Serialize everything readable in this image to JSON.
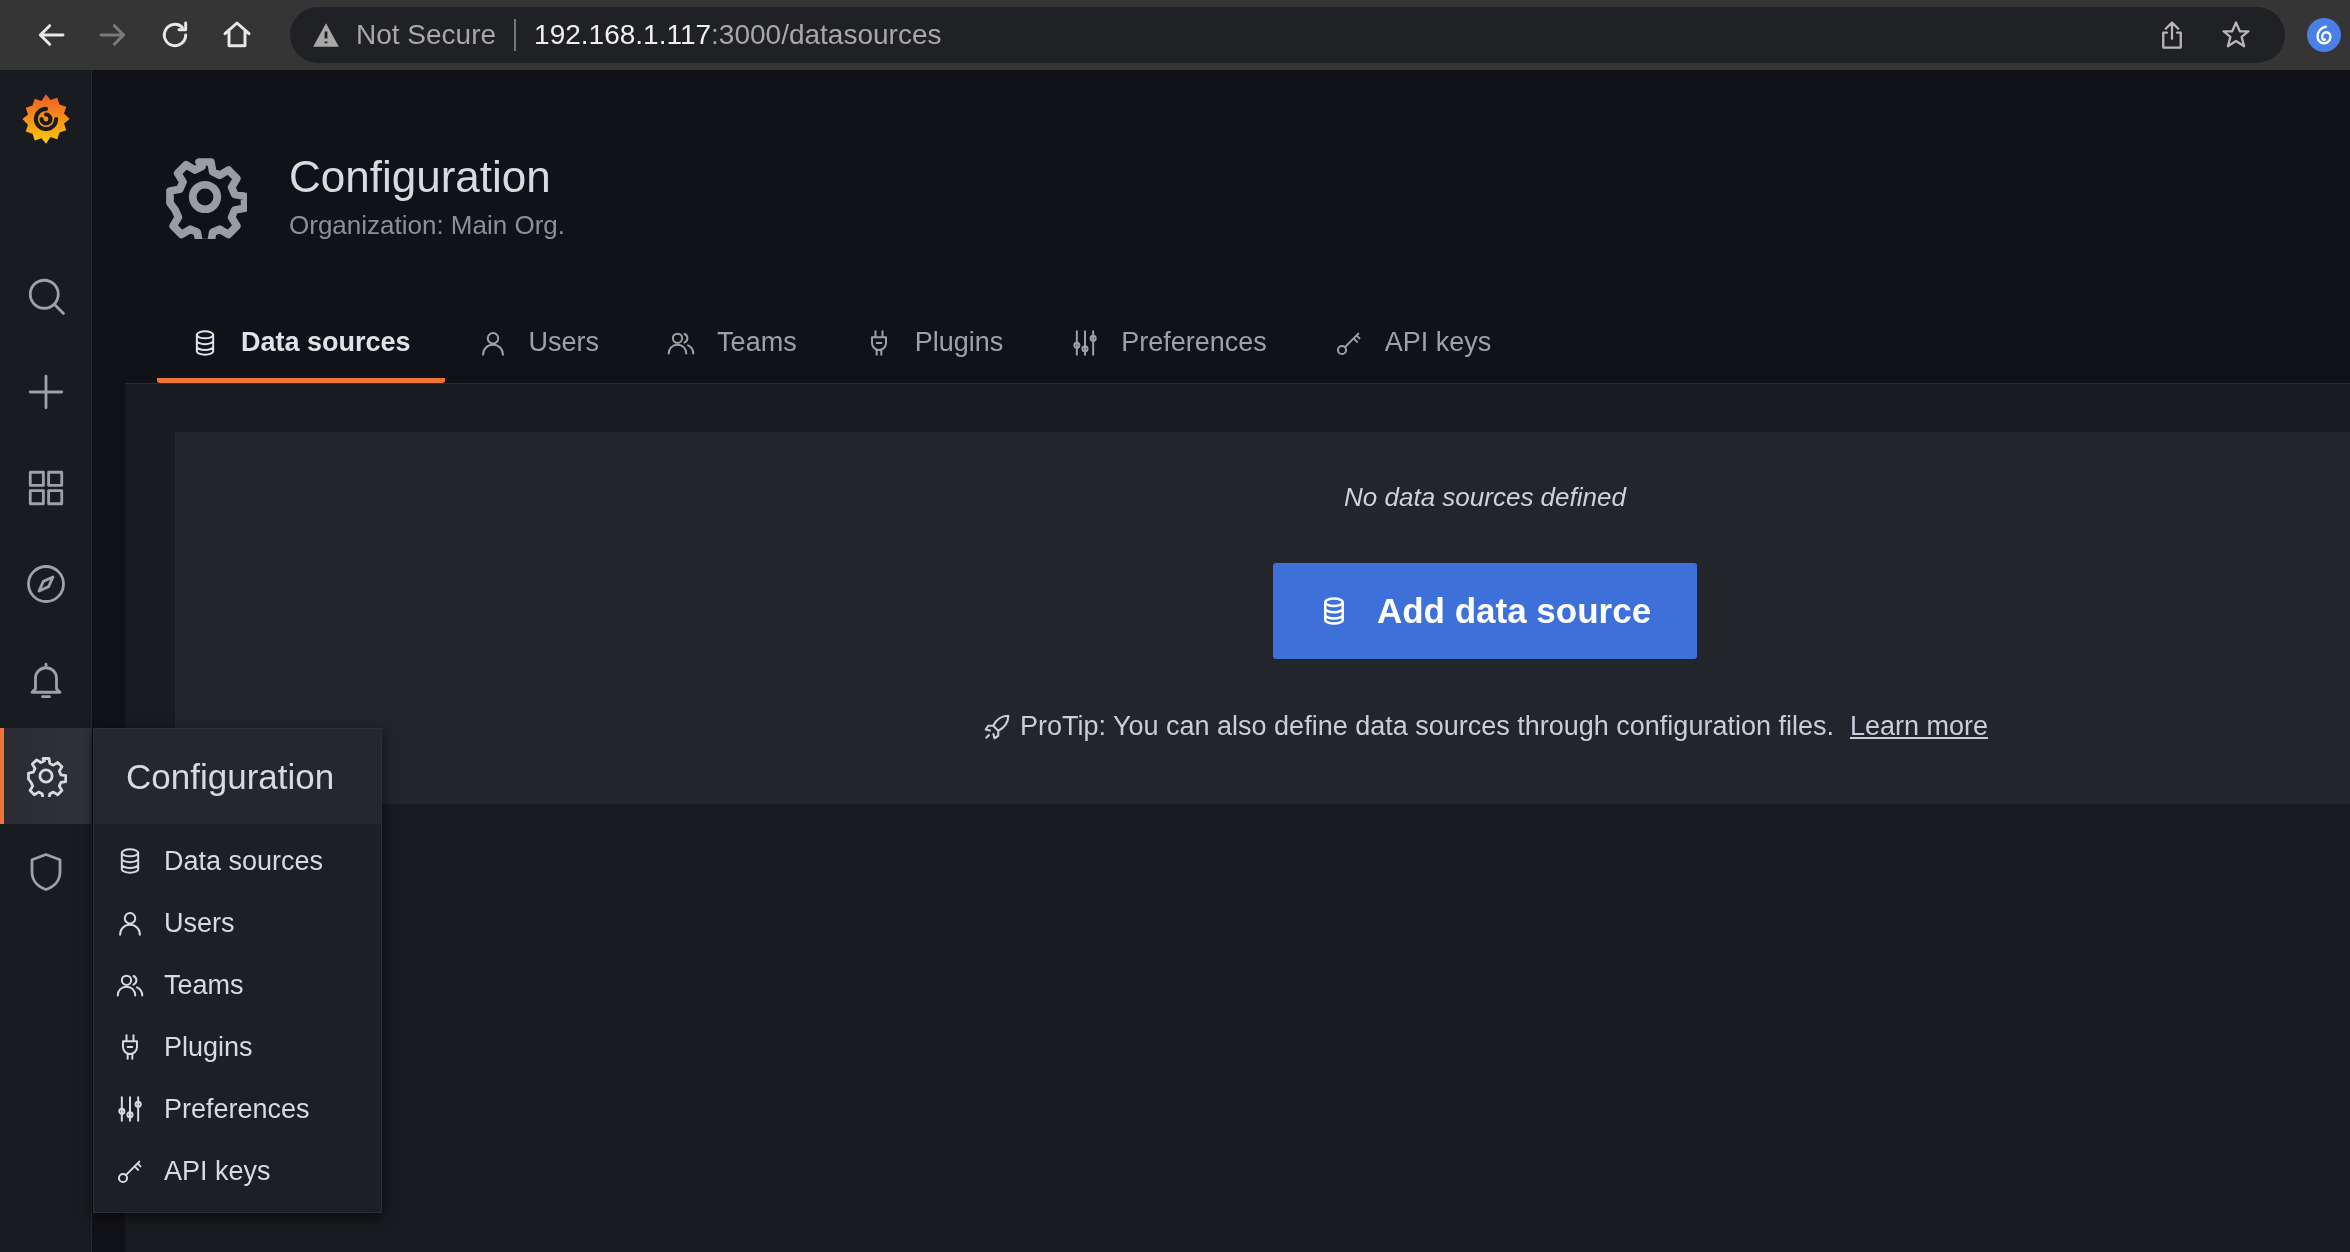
{
  "browser": {
    "nav_buttons": [
      {
        "kind": "back",
        "disabled": false
      },
      {
        "kind": "forward",
        "disabled": true
      },
      {
        "kind": "reload",
        "disabled": false
      },
      {
        "kind": "home",
        "disabled": false
      }
    ],
    "security_label": "Not Secure",
    "url_host": "192.168.1.117",
    "url_path": ":3000/datasources"
  },
  "sidebar": {
    "items": [
      {
        "kind": "search",
        "selected": false
      },
      {
        "kind": "plus",
        "selected": false
      },
      {
        "kind": "apps",
        "selected": false
      },
      {
        "kind": "compass",
        "selected": false
      },
      {
        "kind": "bell",
        "selected": false
      },
      {
        "kind": "gear",
        "selected": true
      },
      {
        "kind": "shield",
        "selected": false
      }
    ]
  },
  "header": {
    "title": "Configuration",
    "subtitle": "Organization: Main Org."
  },
  "tabs": [
    {
      "kind": "database",
      "label": "Data sources",
      "selected": true
    },
    {
      "kind": "user",
      "label": "Users",
      "selected": false
    },
    {
      "kind": "users",
      "label": "Teams",
      "selected": false
    },
    {
      "kind": "plug",
      "label": "Plugins",
      "selected": false
    },
    {
      "kind": "sliders",
      "label": "Preferences",
      "selected": false
    },
    {
      "kind": "key",
      "label": "API keys",
      "selected": false
    }
  ],
  "empty_state": {
    "message": "No data sources defined",
    "button": "Add data source",
    "protip": "ProTip: You can also define data sources through configuration files.",
    "link": "Learn more"
  },
  "flyout_menu": {
    "title": "Configuration",
    "items": [
      {
        "kind": "database",
        "label": "Data sources"
      },
      {
        "kind": "user",
        "label": "Users"
      },
      {
        "kind": "users",
        "label": "Teams"
      },
      {
        "kind": "plug",
        "label": "Plugins"
      },
      {
        "kind": "sliders",
        "label": "Preferences"
      },
      {
        "kind": "key",
        "label": "API keys"
      }
    ]
  }
}
